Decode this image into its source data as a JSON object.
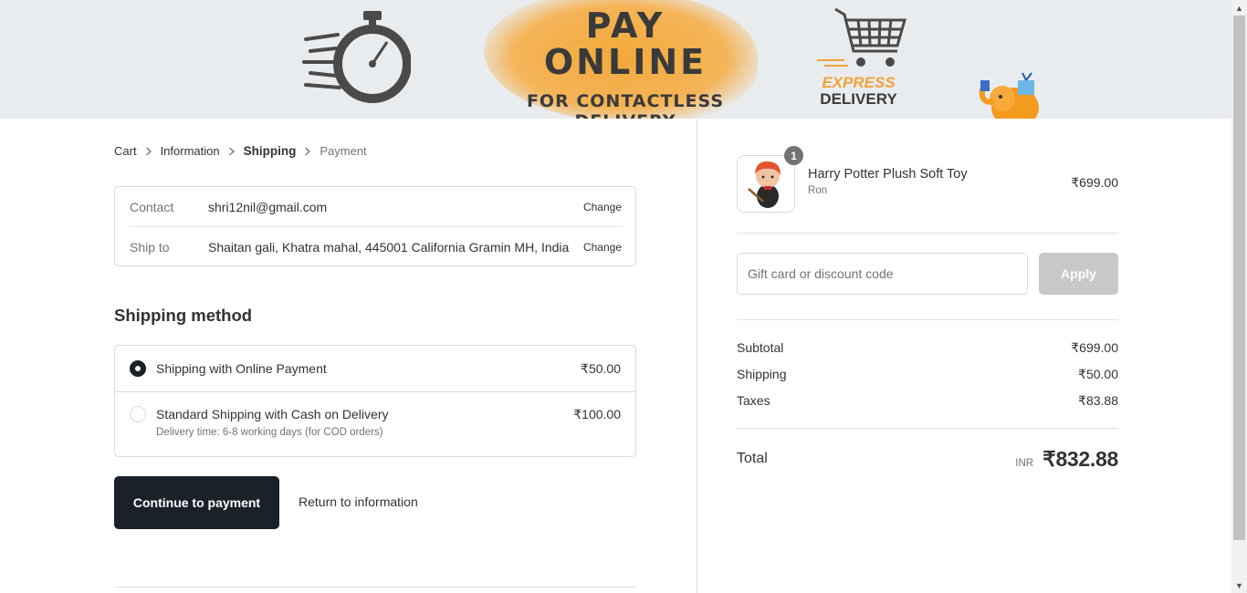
{
  "banner": {
    "headline_1": "PAY",
    "headline_2": "ONLINE",
    "subline": "FOR CONTACTLESS DELIVERY",
    "express": "EXPRESS",
    "delivery": "DELIVERY",
    "icons": [
      "stopwatch-icon",
      "shopping-cart-icon",
      "elephant-mascot-icon"
    ]
  },
  "breadcrumb": {
    "cart": "Cart",
    "information": "Information",
    "shipping": "Shipping",
    "payment": "Payment"
  },
  "review": {
    "contact_label": "Contact",
    "contact_value": "shri12nil@gmail.com",
    "ship_label": "Ship to",
    "ship_value": "Shaitan gali, Khatra mahal, 445001 California Gramin MH, India",
    "change_label": "Change"
  },
  "shipping_method": {
    "title": "Shipping method",
    "options": [
      {
        "name": "Shipping with Online Payment",
        "price": "₹50.00",
        "selected": true
      },
      {
        "name": "Standard Shipping with Cash on Delivery",
        "price": "₹100.00",
        "description": "Delivery time: 6-8 working days (for COD orders)",
        "selected": false
      }
    ]
  },
  "actions": {
    "continue": "Continue to payment",
    "return": "Return to information"
  },
  "order": {
    "product": {
      "name": "Harry Potter Plush Soft Toy",
      "variant": "Ron",
      "price": "₹699.00",
      "quantity": "1"
    },
    "discount": {
      "placeholder": "Gift card or discount code",
      "apply": "Apply"
    },
    "subtotal_label": "Subtotal",
    "subtotal": "₹699.00",
    "shipping_label": "Shipping",
    "shipping": "₹50.00",
    "taxes_label": "Taxes",
    "taxes": "₹83.88",
    "total_label": "Total",
    "currency": "INR",
    "total": "₹832.88"
  },
  "colors": {
    "primary_button": "#1b2129",
    "apply_disabled": "#c8c8c8",
    "banner_accent": "#f2a93b"
  }
}
